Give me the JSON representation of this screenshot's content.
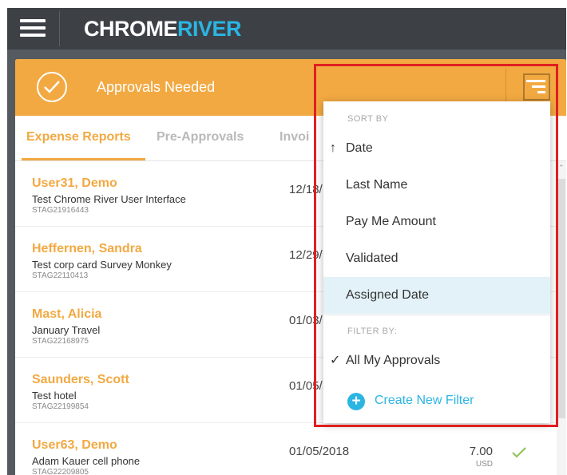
{
  "app": {
    "logo_part1": "CHROME",
    "logo_part2": "RIVER"
  },
  "colors": {
    "accent": "#f2a942",
    "topbar": "#3d4146",
    "link": "#2bb5e3",
    "highlight": "#e3f2f8",
    "annotation": "#e01f1f"
  },
  "header": {
    "title": "Approvals Needed"
  },
  "tabs": [
    {
      "label": "Expense Reports",
      "active": true
    },
    {
      "label": "Pre-Approvals",
      "active": false
    },
    {
      "label": "Invoi",
      "active": false
    }
  ],
  "rows": [
    {
      "name": "User31, Demo",
      "desc": "Test Chrome River User Interface",
      "id": "STAG21916443",
      "date": "12/18/",
      "amount": "",
      "currency": ""
    },
    {
      "name": "Heffernen, Sandra",
      "desc": "Test corp card Survey Monkey",
      "id": "STAG22110413",
      "date": "12/29/",
      "amount": "",
      "currency": ""
    },
    {
      "name": "Mast, Alicia",
      "desc": "January Travel",
      "id": "STAG22168975",
      "date": "01/03/",
      "amount": "",
      "currency": ""
    },
    {
      "name": "Saunders, Scott",
      "desc": "Test hotel",
      "id": "STAG22199854",
      "date": "01/05/",
      "amount": "",
      "currency": ""
    },
    {
      "name": "User63, Demo",
      "desc": "Adam Kauer cell phone",
      "id": "STAG22209805",
      "date": "01/05/2018",
      "amount": "7.00",
      "currency": "USD"
    }
  ],
  "dropdown": {
    "sort_heading": "SORT BY",
    "sort_items": [
      {
        "label": "Date",
        "mark": "↑"
      },
      {
        "label": "Last Name",
        "mark": ""
      },
      {
        "label": "Pay Me Amount",
        "mark": ""
      },
      {
        "label": "Validated",
        "mark": ""
      },
      {
        "label": "Assigned Date",
        "mark": "",
        "highlighted": true
      }
    ],
    "filter_heading": "FILTER BY:",
    "filter_items": [
      {
        "label": "All My Approvals",
        "mark": "✓"
      }
    ],
    "create_filter": "Create New Filter",
    "create_icon": "+"
  }
}
